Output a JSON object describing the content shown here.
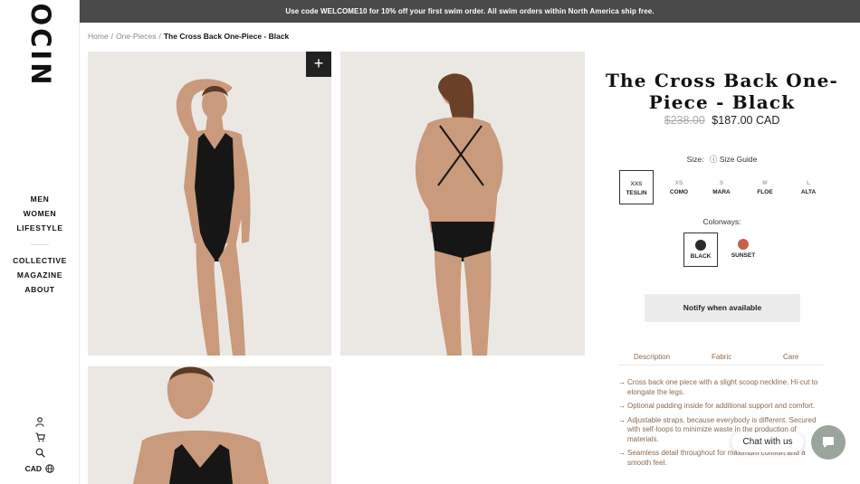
{
  "banner": {
    "text": "Use code WELCOME10 for 10% off your first swim order. All swim orders within North America ship free."
  },
  "sidebar": {
    "logo": "OCIN",
    "nav_main": [
      "MEN",
      "WOMEN",
      "LIFESTYLE"
    ],
    "nav_sub": [
      "COLLECTIVE",
      "MAGAZINE",
      "ABOUT"
    ],
    "icons": [
      "account-icon",
      "cart-icon",
      "search-icon"
    ],
    "currency": "CAD",
    "currency_icon": "globe-icon"
  },
  "breadcrumb": {
    "home": "Home",
    "category": "One-Pieces",
    "current": "The Cross Back One-Piece - Black"
  },
  "gallery": {
    "zoom_icon": "plus-icon",
    "images": [
      "model-front-photo",
      "model-back-photo",
      "model-closeup-photo"
    ]
  },
  "product": {
    "title": "The Cross Back One-Piece - Black",
    "price_old": "$238.00",
    "price_new": "$187.00 CAD",
    "size_label": "Size:",
    "size_guide": "Size Guide",
    "sizes": [
      {
        "size": "XXS",
        "name": "TESLIN",
        "state": "selected"
      },
      {
        "size": "XS",
        "name": "COMO",
        "state": "disabled"
      },
      {
        "size": "S",
        "name": "MARA",
        "state": "disabled"
      },
      {
        "size": "M",
        "name": "FLOE",
        "state": "disabled"
      },
      {
        "size": "L",
        "name": "ALTA",
        "state": "disabled"
      }
    ],
    "colorways_label": "Colorways:",
    "colorways": [
      {
        "name": "BLACK",
        "color": "#2b2b2b",
        "state": "selected"
      },
      {
        "name": "SUNSET",
        "color": "#c9604a",
        "state": "available"
      }
    ],
    "notify_label": "Notify when available",
    "tabs": [
      "Description",
      "Fabric",
      "Care"
    ],
    "description": [
      "Cross back one piece with a slight scoop neckline. Hi-cut to elongate the legs.",
      "Optional padding inside for additional support and comfort.",
      "Adjustable straps, because everybody is different. Secured with self-loops to minimize waste in the production of materials.",
      "Seamless detail throughout for maximum comfort and a smooth feel."
    ]
  },
  "chat": {
    "label": "Chat with us",
    "icon": "chat-bubble-icon"
  },
  "colors": {
    "banner_bg": "#4a4a4a",
    "accent_text": "#8a6a4f",
    "chat_button": "#9aa59b"
  }
}
